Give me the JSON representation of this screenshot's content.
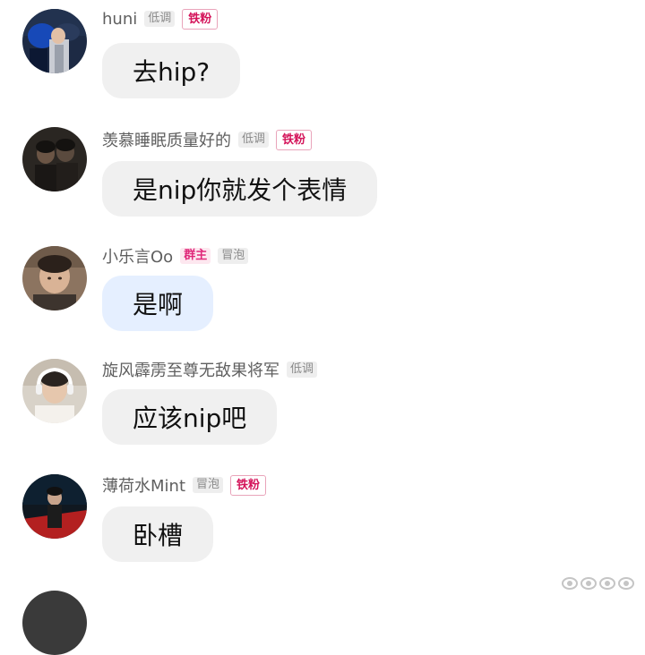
{
  "messages": [
    {
      "username": "huni",
      "tags": [
        {
          "text": "低调",
          "kind": "quiet"
        },
        {
          "text": "铁粉",
          "kind": "fan"
        }
      ],
      "text": "去hip?",
      "bubble_style": "gray",
      "avatar": "dark-blue-jacket-photo"
    },
    {
      "username": "羡慕睡眠质量好的",
      "tags": [
        {
          "text": "低调",
          "kind": "quiet"
        },
        {
          "text": "铁粉",
          "kind": "fan"
        }
      ],
      "text": "是nip你就发个表情",
      "bubble_style": "gray",
      "avatar": "dim-two-people-photo"
    },
    {
      "username": "小乐言Oo",
      "tags": [
        {
          "text": "群主",
          "kind": "owner"
        },
        {
          "text": "冒泡",
          "kind": "quiet"
        }
      ],
      "text": "是啊",
      "bubble_style": "blue",
      "avatar": "young-man-portrait-photo"
    },
    {
      "username": "旋风霹雳至尊无敌果将军",
      "tags": [
        {
          "text": "低调",
          "kind": "quiet"
        }
      ],
      "text": "应该nip吧",
      "bubble_style": "gray",
      "avatar": "gamer-headset-photo"
    },
    {
      "username": "薄荷水Mint",
      "tags": [
        {
          "text": "冒泡",
          "kind": "quiet"
        },
        {
          "text": "铁粉",
          "kind": "fan"
        }
      ],
      "text": "卧槽",
      "bubble_style": "gray",
      "avatar": "stage-red-light-photo"
    }
  ],
  "colors": {
    "bubble_gray": "#f0f0f0",
    "bubble_blue": "#e5efff",
    "fan_tag": "#d4145a",
    "owner_tag": "#e0287a",
    "username": "#5f5f5f"
  }
}
